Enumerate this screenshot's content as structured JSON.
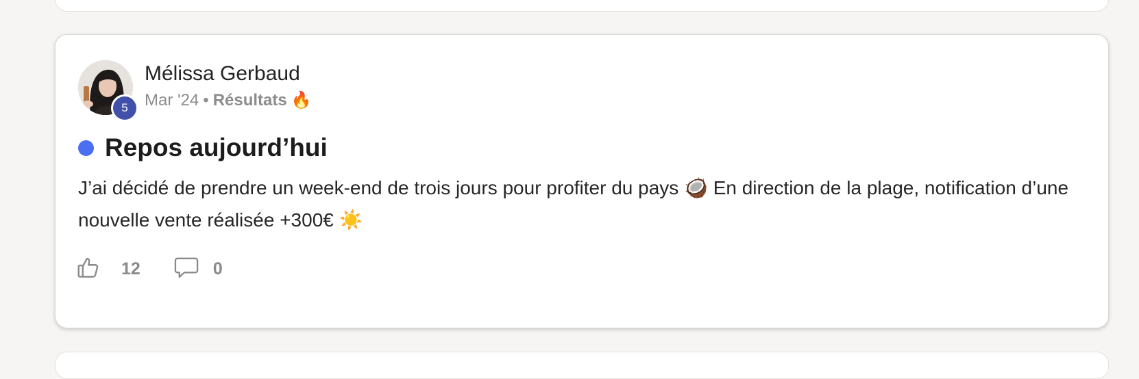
{
  "post": {
    "author": {
      "name": "Mélissa Gerbaud",
      "level": "5"
    },
    "meta": {
      "date": "Mar '24",
      "separator": "•",
      "category": "Résultats",
      "category_emoji": "🔥"
    },
    "title": "Repos aujourd’hui",
    "body": "J’ai décidé de prendre un week-end de trois jours pour profiter du pays 🥥 En direction de la plage, notification d’une nouvelle vente réalisée +300€ ☀️",
    "likes": "12",
    "comments": "0",
    "unread_color": "#4a6ff0"
  },
  "icons": {
    "like": "thumbs-up-icon",
    "comment": "comment-bubble-icon"
  }
}
